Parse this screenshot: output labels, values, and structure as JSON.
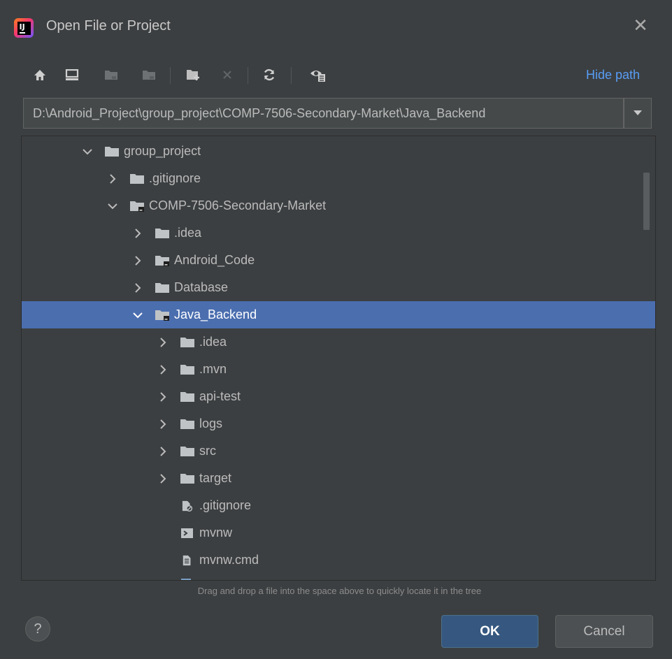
{
  "window": {
    "title": "Open File or Project",
    "logo_letters": "IJ"
  },
  "toolbar": {
    "icons": [
      "home-icon",
      "desktop-icon",
      "project-icon",
      "module-icon",
      "new-folder-icon",
      "delete-icon",
      "refresh-icon",
      "show-hidden-icon"
    ],
    "hide_path_label": "Hide path"
  },
  "path": {
    "value": "D:\\Android_Project\\group_project\\COMP-7506-Secondary-Market\\Java_Backend"
  },
  "tree": {
    "rows": [
      {
        "label": "group_project",
        "icon": "folder",
        "expand": "open"
      },
      {
        "label": ".gitignore",
        "icon": "folder",
        "expand": "closed"
      },
      {
        "label": "COMP-7506-Secondary-Market",
        "icon": "project-folder",
        "expand": "open"
      },
      {
        "label": ".idea",
        "icon": "folder",
        "expand": "closed"
      },
      {
        "label": "Android_Code",
        "icon": "project-folder",
        "expand": "closed"
      },
      {
        "label": "Database",
        "icon": "folder",
        "expand": "closed"
      },
      {
        "label": "Java_Backend",
        "icon": "project-folder",
        "expand": "open",
        "selected": true
      },
      {
        "label": ".idea",
        "icon": "folder",
        "expand": "closed"
      },
      {
        "label": ".mvn",
        "icon": "folder",
        "expand": "closed"
      },
      {
        "label": "api-test",
        "icon": "folder",
        "expand": "closed"
      },
      {
        "label": "logs",
        "icon": "folder",
        "expand": "closed"
      },
      {
        "label": "src",
        "icon": "folder",
        "expand": "closed"
      },
      {
        "label": "target",
        "icon": "folder",
        "expand": "closed"
      },
      {
        "label": ".gitignore",
        "icon": "ignore-file",
        "expand": "none"
      },
      {
        "label": "mvnw",
        "icon": "shell-script",
        "expand": "none"
      },
      {
        "label": "mvnw.cmd",
        "icon": "text-file",
        "expand": "none"
      }
    ]
  },
  "hint": "Drag and drop a file into the space above to quickly locate it in the tree",
  "buttons": {
    "help": "?",
    "ok": "OK",
    "cancel": "Cancel"
  },
  "colors": {
    "background": "#3c3f41",
    "selection": "#4b6eaf",
    "link": "#589df6",
    "ok_button": "#365880"
  }
}
